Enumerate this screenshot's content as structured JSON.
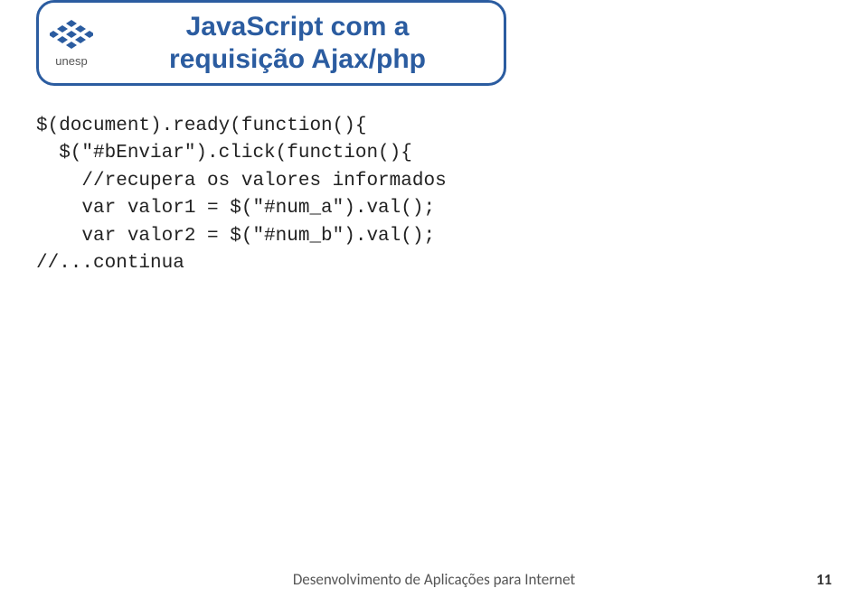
{
  "header": {
    "logo_label": "unesp",
    "title_line1": "JavaScript com a",
    "title_line2": "requisição Ajax/php"
  },
  "code": {
    "line1": "$(document).ready(function(){",
    "line2": "  $(\"#bEnviar\").click(function(){",
    "line3": "    //recupera os valores informados",
    "line4": "    var valor1 = $(\"#num_a\").val();",
    "line5": "    var valor2 = $(\"#num_b\").val();",
    "line6": "//...continua"
  },
  "footer": {
    "text": "Desenvolvimento de Aplicações para Internet",
    "page": "11"
  }
}
